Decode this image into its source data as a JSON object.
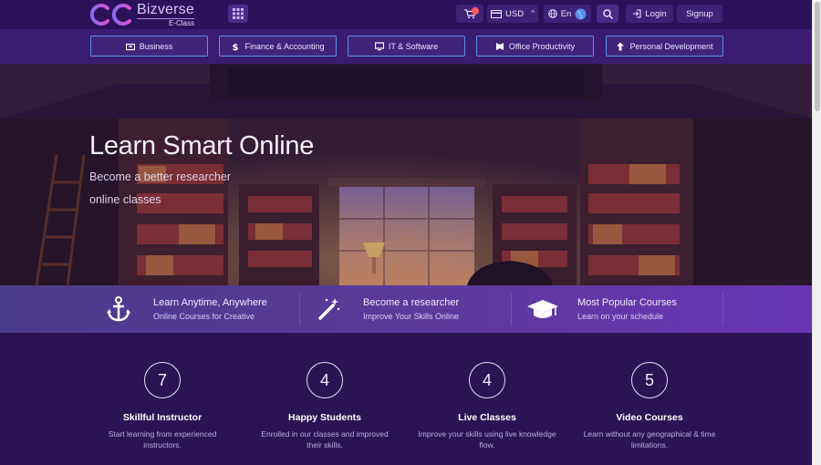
{
  "header": {
    "brand_name": "Bizverse",
    "brand_sub": "E-Class",
    "currency": "USD",
    "language": "En",
    "login_label": "Login",
    "signup_label": "Signup"
  },
  "categories": [
    {
      "label": "Business",
      "icon": "briefcase-icon"
    },
    {
      "label": "Finance & Accounting",
      "icon": "dollar-icon"
    },
    {
      "label": "IT & Software",
      "icon": "monitor-icon"
    },
    {
      "label": "Office Productivity",
      "icon": "office-icon"
    },
    {
      "label": "Personal Development",
      "icon": "arrow-up-icon"
    }
  ],
  "hero": {
    "title": "Learn Smart Online",
    "subtitle_line1": "Become a better researcher",
    "subtitle_line2": "online classes"
  },
  "features": [
    {
      "title": "Learn Anytime, Anywhere",
      "subtitle": "Online Courses for Creative",
      "icon": "anchor-icon"
    },
    {
      "title": "Become a researcher",
      "subtitle": "Improve Your Skills Online",
      "icon": "magic-wand-icon"
    },
    {
      "title": "Most Popular Courses",
      "subtitle": "Learn on your schedule",
      "icon": "graduation-cap-icon"
    }
  ],
  "stats": [
    {
      "value": "7",
      "title": "Skillful Instructor",
      "desc": "Start learning from experienced instructors."
    },
    {
      "value": "4",
      "title": "Happy Students",
      "desc": "Enrolled in our classes and improved their skills."
    },
    {
      "value": "4",
      "title": "Live Classes",
      "desc": "Improve your skills using live knowledge flow."
    },
    {
      "value": "5",
      "title": "Video Courses",
      "desc": "Learn without any geographical & time limitations."
    }
  ],
  "colors": {
    "background": "#2b1454",
    "topbar": "#2b1258",
    "accent_border": "#5b8fe8",
    "badge": "#ff5a5a"
  }
}
